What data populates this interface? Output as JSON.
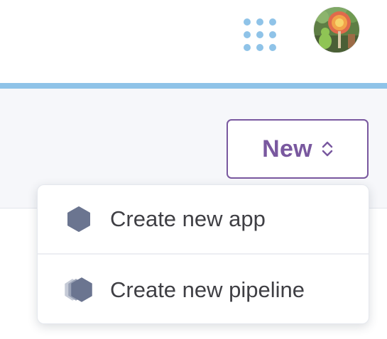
{
  "header": {
    "apps_icon": "apps-grid-icon",
    "avatar_alt": "user avatar",
    "accent_color": "#8fc3e8"
  },
  "toolbar": {
    "new_button_label": "New",
    "new_button_icon": "chevron-up-down-icon",
    "brand_color": "#79589f"
  },
  "dropdown": {
    "items": [
      {
        "label": "Create new app",
        "icon": "app-hexagon-icon"
      },
      {
        "label": "Create new pipeline",
        "icon": "pipeline-stack-icon"
      }
    ]
  }
}
